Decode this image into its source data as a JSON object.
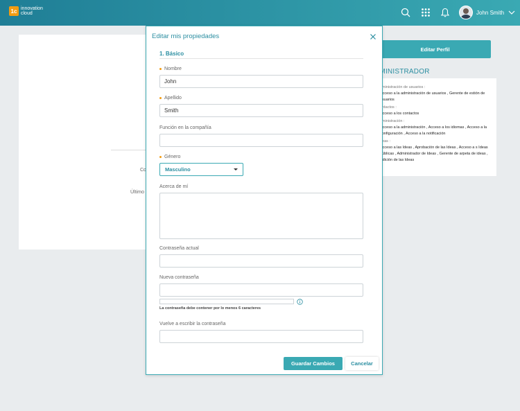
{
  "header": {
    "logo_badge": "1c",
    "logo_line1": "innovation",
    "logo_line2": "cloud",
    "user_name": "John Smith",
    "icons": [
      "search-icon",
      "apps-grid-icon",
      "bell-icon",
      "avatar",
      "chevron-down-icon"
    ],
    "gradient": [
      "#1f7e96",
      "#3aa9b3"
    ]
  },
  "background": {
    "left_fragment_1": "Co",
    "left_fragment_2": "Último",
    "edit_profile_label": "Editar Perfil",
    "admin_title": "DMINISTRADOR",
    "permissions": [
      {
        "category": "dministración de usuarios :",
        "values": "Acceso a la administración de usuarios , Gerente de estión de usuarios"
      },
      {
        "category": "ontactos :",
        "values": "Acceso a los contactos"
      },
      {
        "category": "dministración :",
        "values": "Acceso a la administración , Acceso a los idiomas , Acceso a la configuración , Acceso a la notificación"
      },
      {
        "category": "deas :",
        "values": "Acceso a las Ideas , Aprobación de las Ideas , Acceso a s Ideas públicas , Administrador de Ideas , Gerente de arpeta de ideas , Adición de las Ideas"
      }
    ]
  },
  "modal": {
    "title": "Editar mis propiedades",
    "section": "1. Básico",
    "fields": {
      "nombre": {
        "label": "Nombre",
        "value": "John"
      },
      "apellido": {
        "label": "Apellido",
        "value": "Smith"
      },
      "funcion": {
        "label": "Función en la compañía",
        "value": ""
      },
      "genero": {
        "label": "Género",
        "value": "Masculino"
      },
      "acerca": {
        "label": "Acerca de mí",
        "value": ""
      },
      "contrasena_actual": {
        "label": "Contraseña actual",
        "value": ""
      },
      "nueva_contrasena": {
        "label": "Nueva contraseña",
        "value": ""
      },
      "repetir_contrasena": {
        "label": "Vuelve a escribir la contraseña",
        "value": ""
      }
    },
    "password_hint": "La contraseña debe contener por lo menos 6 caracteres",
    "save_label": "Guardar Cambios",
    "cancel_label": "Cancelar"
  },
  "colors": {
    "accent": "#3aa9b3",
    "accent_dark": "#2b8ea1",
    "required": "#f39c12",
    "background": "#e9ecee"
  }
}
